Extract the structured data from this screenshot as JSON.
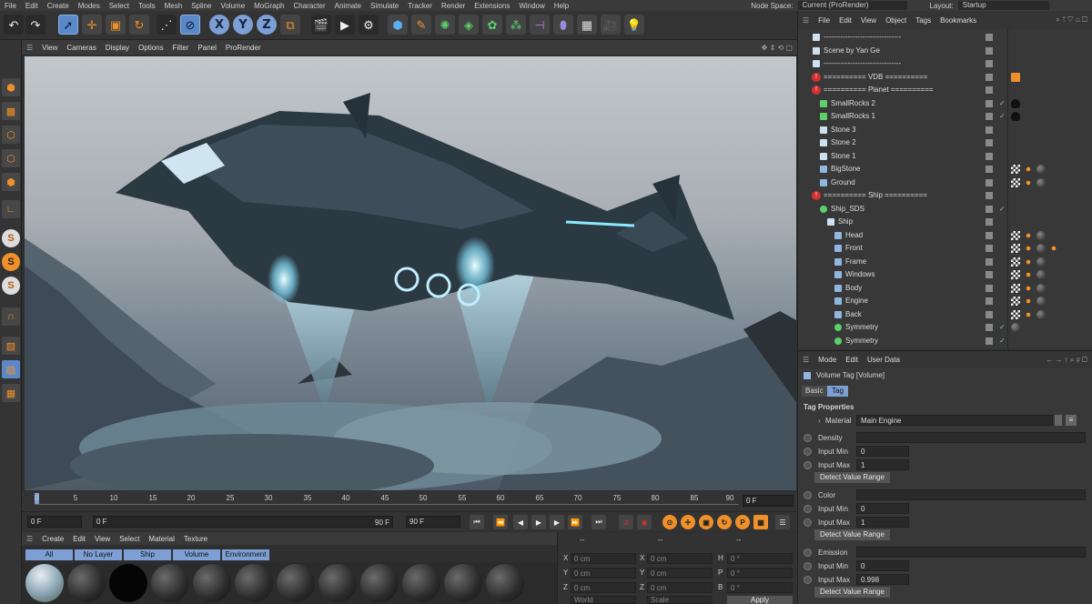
{
  "menubar": {
    "items": [
      "File",
      "Edit",
      "Create",
      "Modes",
      "Select",
      "Tools",
      "Mesh",
      "Spline",
      "Volume",
      "MoGraph",
      "Character",
      "Animate",
      "Simulate",
      "Tracker",
      "Render",
      "Extensions",
      "Window",
      "Help"
    ],
    "node_space_label": "Node Space:",
    "node_space_value": "Current (ProRender)",
    "layout_label": "Layout:",
    "layout_value": "Startup"
  },
  "toolbar": {
    "axis_x": "X",
    "axis_y": "Y",
    "axis_z": "Z"
  },
  "viewport": {
    "menu": [
      "View",
      "Cameras",
      "Display",
      "Options",
      "Filter",
      "Panel",
      "ProRender"
    ]
  },
  "timeline": {
    "ticks": [
      "0",
      "5",
      "10",
      "15",
      "20",
      "25",
      "30",
      "35",
      "40",
      "45",
      "50",
      "55",
      "60",
      "65",
      "70",
      "75",
      "80",
      "85",
      "90"
    ],
    "end_frame": "0 F"
  },
  "playbar": {
    "start": "0 F",
    "current": "0 F",
    "end_a": "90 F",
    "end_b": "90 F"
  },
  "materials": {
    "menu": [
      "Create",
      "Edit",
      "View",
      "Select",
      "Material",
      "Texture"
    ],
    "tabs": [
      "All",
      "No Layer",
      "Ship",
      "Volume",
      "Environment"
    ]
  },
  "coords": {
    "header_a": "--",
    "header_b": "--",
    "header_c": "--",
    "rows": [
      {
        "a": "X",
        "av": "0 cm",
        "b": "X",
        "bv": "0 cm",
        "c": "H",
        "cv": "0 °"
      },
      {
        "a": "Y",
        "av": "0 cm",
        "b": "Y",
        "bv": "0 cm",
        "c": "P",
        "cv": "0 °"
      },
      {
        "a": "Z",
        "av": "0 cm",
        "b": "Z",
        "bv": "0 cm",
        "c": "B",
        "cv": "0 °"
      }
    ],
    "world": "World",
    "scale": "Scale",
    "apply": "Apply"
  },
  "objects": {
    "menu": [
      "File",
      "Edit",
      "View",
      "Object",
      "Tags",
      "Bookmarks"
    ],
    "rows": [
      {
        "name": "--------------------------------"
      },
      {
        "name": "Scene by Yan Ge"
      },
      {
        "name": "--------------------------------"
      },
      {
        "name": "========== VDB =========="
      },
      {
        "name": "========== Planet =========="
      },
      {
        "name": "SmallRocks 2"
      },
      {
        "name": "SmallRocks 1"
      },
      {
        "name": "Stone 3"
      },
      {
        "name": "Stone 2"
      },
      {
        "name": "Stone 1"
      },
      {
        "name": "BigStone"
      },
      {
        "name": "Ground"
      },
      {
        "name": "========== Ship =========="
      },
      {
        "name": "Ship_SDS"
      },
      {
        "name": "Ship"
      },
      {
        "name": "Head"
      },
      {
        "name": "Front"
      },
      {
        "name": "Frame"
      },
      {
        "name": "Windows"
      },
      {
        "name": "Body"
      },
      {
        "name": "Engine"
      },
      {
        "name": "Back"
      },
      {
        "name": "Symmetry"
      },
      {
        "name": "Symmetry"
      }
    ]
  },
  "attributes": {
    "menu": [
      "Mode",
      "Edit",
      "User Data"
    ],
    "title": "Volume Tag [Volume]",
    "tabs": [
      "Basic",
      "Tag"
    ],
    "section": "Tag Properties",
    "material_label": "Material",
    "material_value": "Main Engine",
    "groups": [
      {
        "label": "Density",
        "min_label": "Input Min",
        "min": "0",
        "max_label": "Input Max",
        "max": "1",
        "button": "Detect Value Range"
      },
      {
        "label": "Color",
        "min_label": "Input Min",
        "min": "0",
        "max_label": "Input Max",
        "max": "1",
        "button": "Detect Value Range"
      },
      {
        "label": "Emission",
        "min_label": "Input Min",
        "min": "0",
        "max_label": "Input Max",
        "max": "0.998",
        "button": "Detect Value Range"
      }
    ]
  }
}
